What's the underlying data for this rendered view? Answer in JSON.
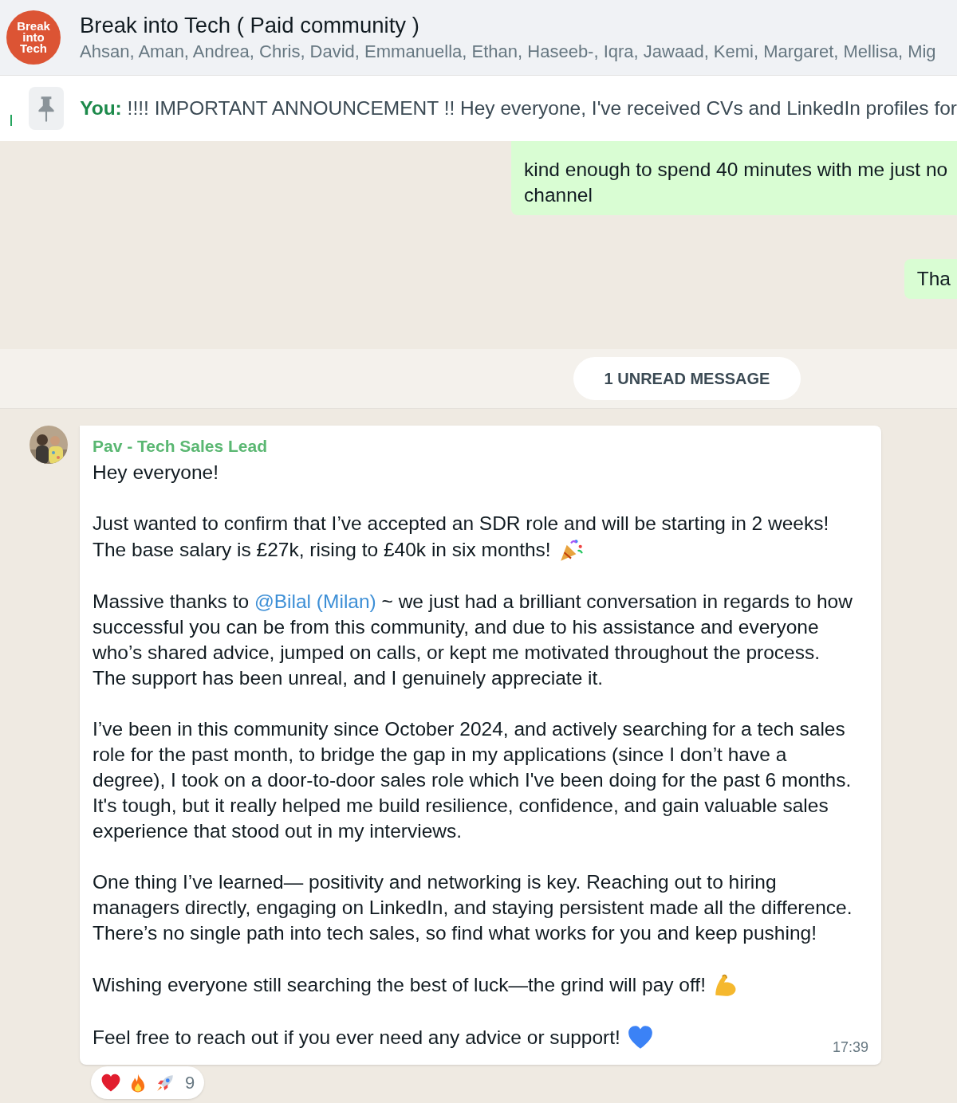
{
  "header": {
    "logo_lines": [
      "Break",
      "into",
      "Tech"
    ],
    "title": "Break into Tech ( Paid community )",
    "members": "Ahsan, Aman, Andrea, Chris, David, Emmanuella, Ethan, Haseeb-, Iqra, Jawaad, Kemi, Margaret, Mellisa, Mig"
  },
  "pinned": {
    "sender": "You:",
    "text": "!!!! IMPORTANT ANNOUNCEMENT !! Hey everyone,  I've received CVs and LinkedIn profiles for"
  },
  "outgoing": [
    {
      "lines": [
        "kind enough to spend 40 minutes with me just no",
        "channel"
      ]
    },
    {
      "lines": [
        "Tha"
      ]
    }
  ],
  "unread": "1 UNREAD MESSAGE",
  "message": {
    "sender": "Pav - Tech Sales Lead",
    "time": "17:39",
    "paragraphs": [
      {
        "lines": [
          "Hey everyone!"
        ]
      },
      {
        "lines": [
          "Just wanted to confirm that I’ve accepted an SDR role and will be starting in 2 weeks!",
          "The base salary is £27k, rising to £40k in six months!"
        ],
        "emoji": {
          "kind": "party"
        }
      },
      {
        "lines": [
          {
            "before": "Massive thanks to ",
            "mention": "@Bilal (Milan)",
            "after": "  ~ we just had a brilliant conversation in regards to how"
          },
          "successful you can be from this community, and due to his assistance and everyone",
          "who’s shared advice, jumped on calls, or kept me motivated throughout the process.",
          "The support has been unreal, and I genuinely appreciate it."
        ]
      },
      {
        "lines": [
          "I’ve been in this community since October 2024, and actively searching for a tech sales",
          "role for the past month, to bridge the gap in my applications (since I don’t have a",
          "degree), I took on a door-to-door sales role which I've been doing for the past 6 months.",
          "It's tough, but it really helped me build resilience, confidence, and gain valuable sales",
          "experience that stood out in my interviews."
        ]
      },
      {
        "lines": [
          "One thing I’ve learned— positivity and networking is key. Reaching out to hiring",
          "managers directly, engaging on LinkedIn, and staying persistent made all the difference.",
          "There’s no single path into tech sales, so find what works for you and keep pushing!"
        ]
      },
      {
        "lines": [
          "Wishing everyone still searching the best of luck—the grind will pay off!"
        ],
        "emoji": {
          "kind": "flex"
        }
      },
      {
        "lines": [
          "Feel free to reach out if you ever need any advice or support!"
        ],
        "emoji": {
          "kind": "heart"
        }
      }
    ],
    "reactions": {
      "items": [
        {
          "kind": "heart"
        },
        {
          "kind": "fire"
        },
        {
          "kind": "rocket"
        }
      ],
      "count": "9"
    }
  }
}
